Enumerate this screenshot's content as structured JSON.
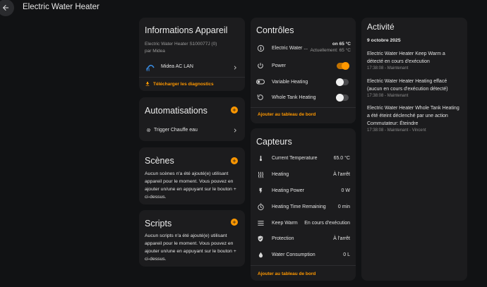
{
  "header": {
    "title": "Electric Water Heater"
  },
  "device_info": {
    "title": "Informations Appareil",
    "model": "Electric Water Heater S100077J (0)",
    "manufacturer": "par Midea",
    "integration": "Midea AC LAN",
    "download": "Télécharger les diagnostics"
  },
  "automations": {
    "title": "Automatisations",
    "items": [
      {
        "label": "Trigger Chauffe eau"
      }
    ]
  },
  "scenes": {
    "title": "Scènes",
    "empty_text": "Aucun scènes n'a été ajouté(e) utilisant appareil pour le moment. Vous pouvez en ajouter un/une en appuyant sur le bouton + ci-dessus."
  },
  "scripts": {
    "title": "Scripts",
    "empty_text": "Aucun scripts n'a été ajouté(e) utilisant appareil pour le moment. Vous pouvez en ajouter un/une en appuyant sur le bouton + ci-dessus."
  },
  "controls": {
    "title": "Contrôles",
    "climate": {
      "name": "Electric Water ...",
      "state": "on 65 °C",
      "current": "Actuellement: 65 °C"
    },
    "items": [
      {
        "label": "Power",
        "on": true
      },
      {
        "label": "Variable Heating",
        "on": false
      },
      {
        "label": "Whole Tank Heating",
        "on": false
      }
    ],
    "add_label": "Ajouter au tableau de bord"
  },
  "sensors": {
    "title": "Capteurs",
    "items": [
      {
        "label": "Current Temperature",
        "value": "65.0 °C",
        "icon": "thermometer-icon"
      },
      {
        "label": "Heating",
        "value": "À l'arrêt",
        "icon": "heat-waves-icon"
      },
      {
        "label": "Heating Power",
        "value": "0 W",
        "icon": "flash-icon"
      },
      {
        "label": "Heating Time Remaining",
        "value": "0 min",
        "icon": "timer-icon"
      },
      {
        "label": "Keep Warm",
        "value": "En cours d'exécution",
        "icon": "keep-warm-icon"
      },
      {
        "label": "Protection",
        "value": "À l'arrêt",
        "icon": "shield-check-icon"
      },
      {
        "label": "Water Consumption",
        "value": "0 L",
        "icon": "water-drop-icon"
      }
    ],
    "add_label": "Ajouter au tableau de bord"
  },
  "activity": {
    "title": "Activité",
    "date": "9 octobre 2025",
    "items": [
      {
        "text": "Electric Water Heater Keep Warm a détecté en cours d'exécution",
        "meta": "17:38:08 - Maintenant"
      },
      {
        "text": "Electric Water Heater Heating effacé (aucun en cours d'exécution détecté)",
        "meta": "17:38:08 - Maintenant"
      },
      {
        "text": "Electric Water Heater Whole Tank Heating a été éteint déclenché par une action Commutateur: Éteindre",
        "meta": "17:38:08 - Maintenant - Vincent"
      }
    ]
  },
  "colors": {
    "accent": "#ff9800",
    "card": "#1c1c1e",
    "background": "#111214"
  }
}
